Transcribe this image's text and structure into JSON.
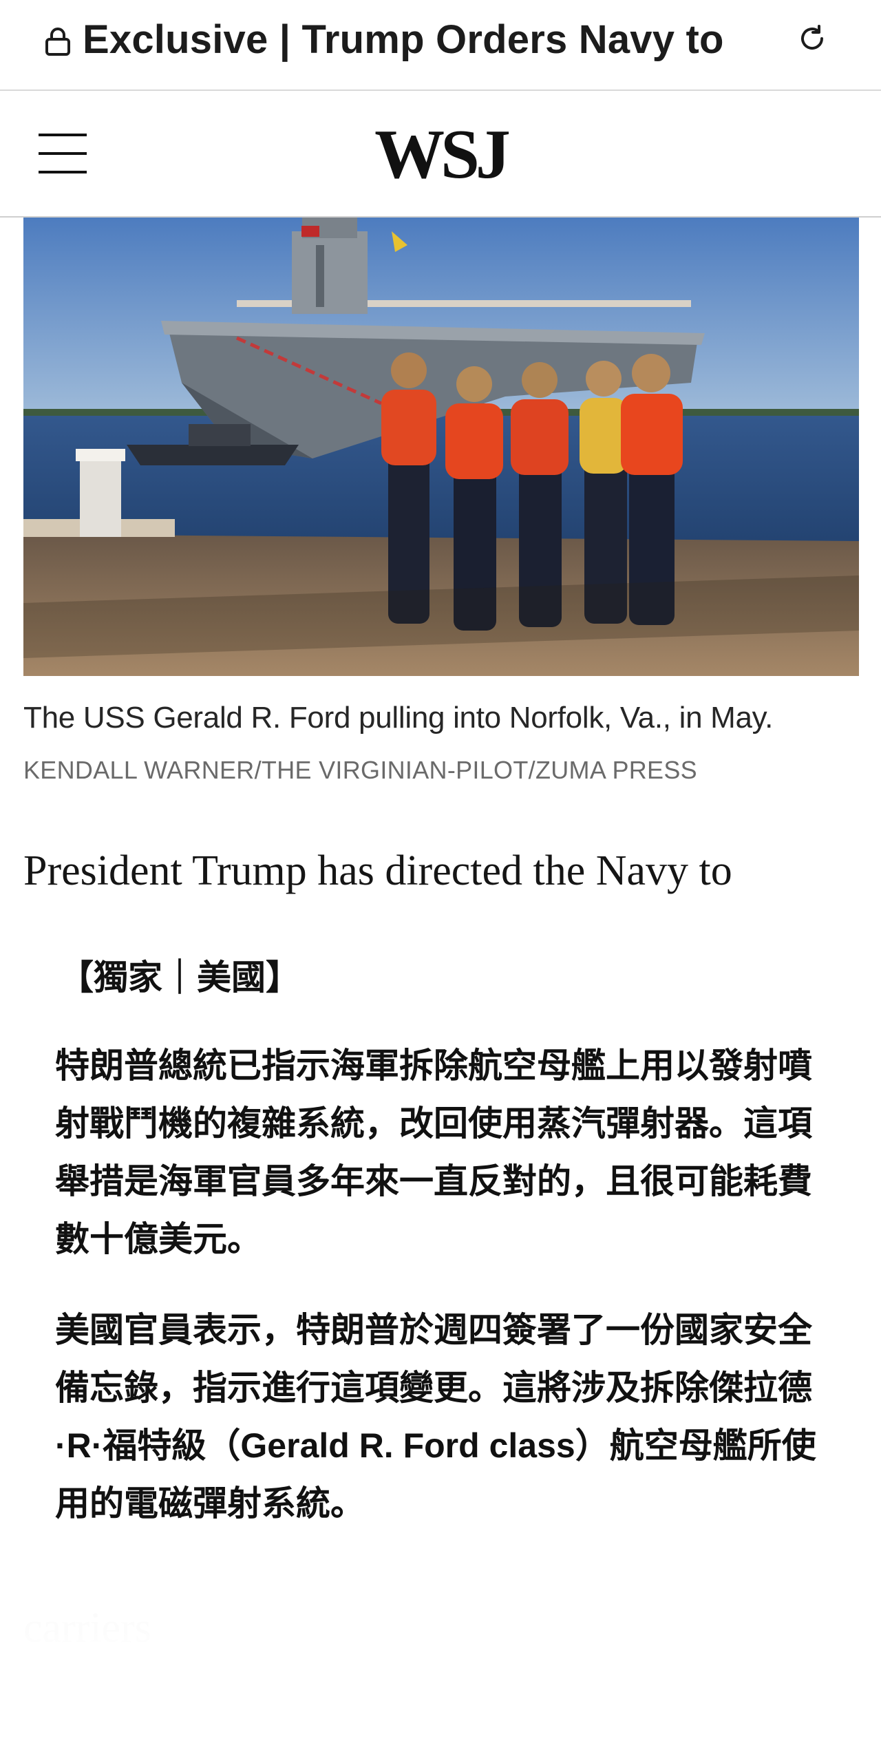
{
  "browser": {
    "tab_title": "Exclusive | Trump Orders Navy to"
  },
  "header": {
    "logo": "WSJ"
  },
  "article": {
    "photo": {
      "caption": "The USS Gerald R. Ford pulling into Norfolk, Va., in May.",
      "credit": "KENDALL WARNER/THE VIRGINIAN-PILOT/ZUMA PRESS"
    },
    "lede": "President Trump has directed the Navy to",
    "translation_tag": "【獨家｜美國】",
    "paragraphs": [
      "特朗普總統已指示海軍拆除航空母艦上用以發射噴射戰鬥機的複雜系統，改回使用蒸汽彈射器。這項舉措是海軍官員多年來一直反對的，且很可能耗費數十億美元。",
      "美國官員表示，特朗普於週四簽署了一份國家安全備忘錄，指示進行這項變更。這將涉及拆除傑拉德·R·福特級（Gerald R. Ford class）航空母艦所使用的電磁彈射系統。"
    ],
    "faded_text": "carriers"
  },
  "icons": {
    "lock": "lock-icon",
    "reload": "reload-icon",
    "menu": "hamburger-menu-icon"
  }
}
